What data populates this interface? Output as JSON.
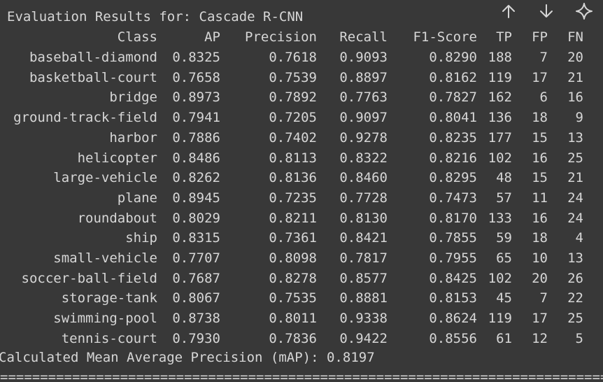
{
  "toolbar": {
    "move_up_icon": "arrow-up",
    "move_down_icon": "arrow-down",
    "sparkle_icon": "sparkle"
  },
  "output": {
    "title": "Evaluation Results for: Cascade R-CNN",
    "headers": [
      "Class",
      "AP",
      "Precision",
      "Recall",
      "F1-Score",
      "TP",
      "FP",
      "FN"
    ],
    "rows": [
      {
        "class": "baseball-diamond",
        "ap": "0.8325",
        "precision": "0.7618",
        "recall": "0.9093",
        "f1": "0.8290",
        "tp": "188",
        "fp": "7",
        "fn": "20"
      },
      {
        "class": "basketball-court",
        "ap": "0.7658",
        "precision": "0.7539",
        "recall": "0.8897",
        "f1": "0.8162",
        "tp": "119",
        "fp": "17",
        "fn": "21"
      },
      {
        "class": "bridge",
        "ap": "0.8973",
        "precision": "0.7892",
        "recall": "0.7763",
        "f1": "0.7827",
        "tp": "162",
        "fp": "6",
        "fn": "16"
      },
      {
        "class": "ground-track-field",
        "ap": "0.7941",
        "precision": "0.7205",
        "recall": "0.9097",
        "f1": "0.8041",
        "tp": "136",
        "fp": "18",
        "fn": "9"
      },
      {
        "class": "harbor",
        "ap": "0.7886",
        "precision": "0.7402",
        "recall": "0.9278",
        "f1": "0.8235",
        "tp": "177",
        "fp": "15",
        "fn": "13"
      },
      {
        "class": "helicopter",
        "ap": "0.8486",
        "precision": "0.8113",
        "recall": "0.8322",
        "f1": "0.8216",
        "tp": "102",
        "fp": "16",
        "fn": "25"
      },
      {
        "class": "large-vehicle",
        "ap": "0.8262",
        "precision": "0.8136",
        "recall": "0.8460",
        "f1": "0.8295",
        "tp": "48",
        "fp": "15",
        "fn": "21"
      },
      {
        "class": "plane",
        "ap": "0.8945",
        "precision": "0.7235",
        "recall": "0.7728",
        "f1": "0.7473",
        "tp": "57",
        "fp": "11",
        "fn": "24"
      },
      {
        "class": "roundabout",
        "ap": "0.8029",
        "precision": "0.8211",
        "recall": "0.8130",
        "f1": "0.8170",
        "tp": "133",
        "fp": "16",
        "fn": "24"
      },
      {
        "class": "ship",
        "ap": "0.8315",
        "precision": "0.7361",
        "recall": "0.8421",
        "f1": "0.7855",
        "tp": "59",
        "fp": "18",
        "fn": "4"
      },
      {
        "class": "small-vehicle",
        "ap": "0.7707",
        "precision": "0.8098",
        "recall": "0.7817",
        "f1": "0.7955",
        "tp": "65",
        "fp": "10",
        "fn": "13"
      },
      {
        "class": "soccer-ball-field",
        "ap": "0.7687",
        "precision": "0.8278",
        "recall": "0.8577",
        "f1": "0.8425",
        "tp": "102",
        "fp": "20",
        "fn": "26"
      },
      {
        "class": "storage-tank",
        "ap": "0.8067",
        "precision": "0.7535",
        "recall": "0.8881",
        "f1": "0.8153",
        "tp": "45",
        "fp": "7",
        "fn": "22"
      },
      {
        "class": "swimming-pool",
        "ap": "0.8738",
        "precision": "0.8011",
        "recall": "0.9338",
        "f1": "0.8624",
        "tp": "119",
        "fp": "17",
        "fn": "25"
      },
      {
        "class": "tennis-court",
        "ap": "0.7930",
        "precision": "0.7836",
        "recall": "0.9422",
        "f1": "0.8556",
        "tp": "61",
        "fp": "12",
        "fn": "5"
      }
    ],
    "map_line": "Calculated Mean Average Precision (mAP): 0.8197",
    "divider": "=========================================================================================================="
  }
}
